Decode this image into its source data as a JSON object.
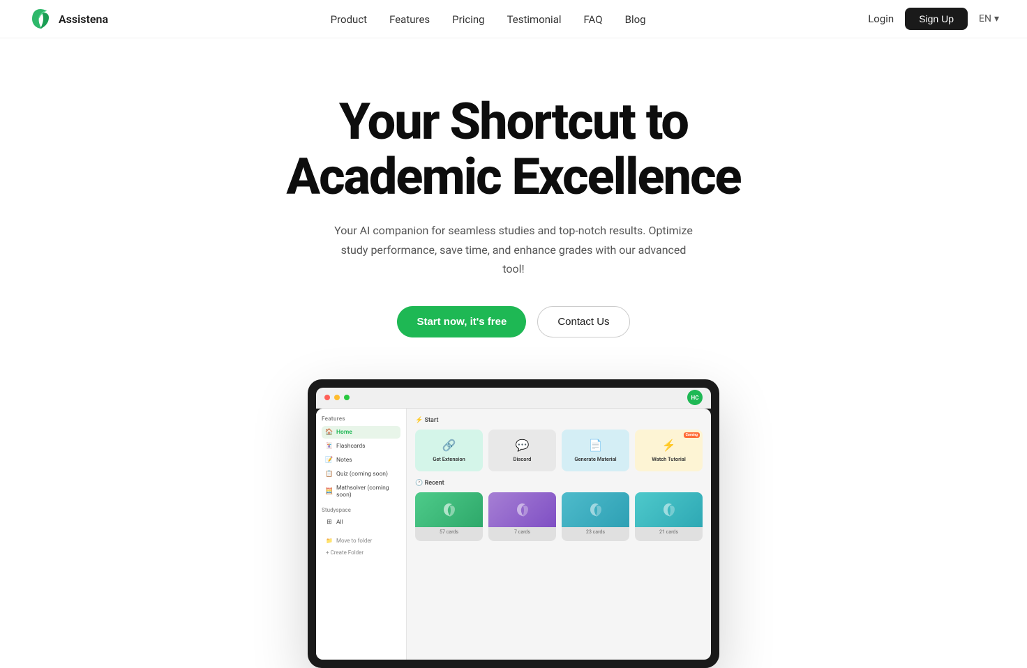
{
  "brand": {
    "name": "Assistena",
    "logo_alt": "Assistena logo"
  },
  "nav": {
    "links": [
      {
        "label": "Product",
        "href": "#"
      },
      {
        "label": "Features",
        "href": "#"
      },
      {
        "label": "Pricing",
        "href": "#"
      },
      {
        "label": "Testimonial",
        "href": "#"
      },
      {
        "label": "FAQ",
        "href": "#"
      },
      {
        "label": "Blog",
        "href": "#"
      }
    ],
    "login_label": "Login",
    "signup_label": "Sign Up",
    "lang_label": "EN"
  },
  "hero": {
    "title_line1": "Your Shortcut to",
    "title_line2": "Academic Excellence",
    "subtitle": "Your AI companion for seamless studies and top-notch results. Optimize study performance, save time, and enhance grades with our advanced tool!",
    "cta_primary": "Start now, it's free",
    "cta_secondary": "Contact Us"
  },
  "app": {
    "sidebar_title": "Features",
    "sidebar_items": [
      {
        "label": "Home",
        "icon": "🏠",
        "active": true
      },
      {
        "label": "Flashcards",
        "icon": "🃏",
        "active": false
      },
      {
        "label": "Notes",
        "icon": "📝",
        "active": false
      },
      {
        "label": "Quiz (coming soon)",
        "icon": "📋",
        "active": false
      },
      {
        "label": "Mathsolver (coming soon)",
        "icon": "🧮",
        "active": false
      }
    ],
    "studyspace_label": "Studyspace",
    "studyspace_items": [
      {
        "label": "All",
        "icon": "⊞"
      }
    ],
    "bottom_items": [
      {
        "label": "Move to folder",
        "icon": "📁"
      },
      {
        "label": "+ Create Folder",
        "icon": ""
      }
    ],
    "start_section": "⚡ Start",
    "cards": [
      {
        "label": "Get Extension",
        "icon": "🔗",
        "color": "card-green",
        "badge": ""
      },
      {
        "label": "Discord",
        "icon": "💬",
        "color": "card-gray",
        "badge": ""
      },
      {
        "label": "Generate Material",
        "icon": "📄",
        "color": "card-teal",
        "badge": ""
      },
      {
        "label": "Watch Tutorial",
        "icon": "⚡",
        "color": "card-yellow",
        "badge": "Coming"
      }
    ],
    "recent_section": "🕐 Recent",
    "recent_cards": [
      {
        "label": "57 cards",
        "color": "rc-green"
      },
      {
        "label": "7 cards",
        "color": "rc-purple"
      },
      {
        "label": "23 cards",
        "color": "rc-teal"
      },
      {
        "label": "21 cards",
        "color": "rc-cyan"
      }
    ],
    "avatar_initials": "HC"
  }
}
